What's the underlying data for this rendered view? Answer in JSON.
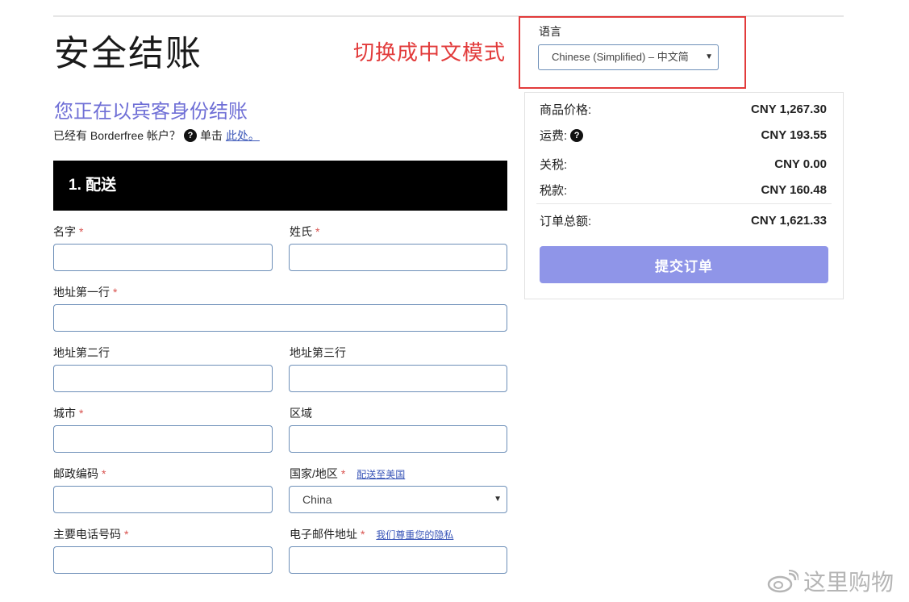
{
  "page": {
    "title": "安全结账",
    "annotation": "切换成中文模式"
  },
  "language": {
    "label": "语言",
    "selected": "Chinese (Simplified) – 中文简"
  },
  "guest": {
    "heading": "您正在以宾客身份结账",
    "account_prompt": "已经有 Borderfree 帐户？",
    "click_text": "单击",
    "click_link": "此处。"
  },
  "shipping": {
    "section_title": "1. 配送",
    "first_name_label": "名字",
    "last_name_label": "姓氏",
    "address1_label": "地址第一行",
    "address2_label": "地址第二行",
    "address3_label": "地址第三行",
    "city_label": "城市",
    "region_label": "区域",
    "postal_label": "邮政编码",
    "country_label": "国家/地区",
    "ship_to_us_link": "配送至美国",
    "country_value": "China",
    "phone_label": "主要电话号码",
    "email_label": "电子邮件地址",
    "privacy_link": "我们尊重您的隐私",
    "required_marker": "*"
  },
  "summary": {
    "item_price_label": "商品价格:",
    "item_price": "CNY 1,267.30",
    "shipping_label": "运费:",
    "shipping": "CNY 193.55",
    "duties_label": "关税:",
    "duties": "CNY 0.00",
    "tax_label": "税款:",
    "tax": "CNY 160.48",
    "total_label": "订单总额:",
    "total": "CNY 1,621.33",
    "submit_label": "提交订单"
  },
  "watermark": {
    "text": "这里购物"
  },
  "icons": {
    "help": "question-circle-icon",
    "dropdown": "caret-down-icon",
    "logo": "weibo-icon"
  },
  "colors": {
    "heading_accent": "#6f6fd6",
    "annotation_red": "#e23b3b",
    "submit_button": "#8f95e8",
    "section_bar": "#000000",
    "input_border": "#6d8fb8",
    "link": "#3a56b8"
  }
}
